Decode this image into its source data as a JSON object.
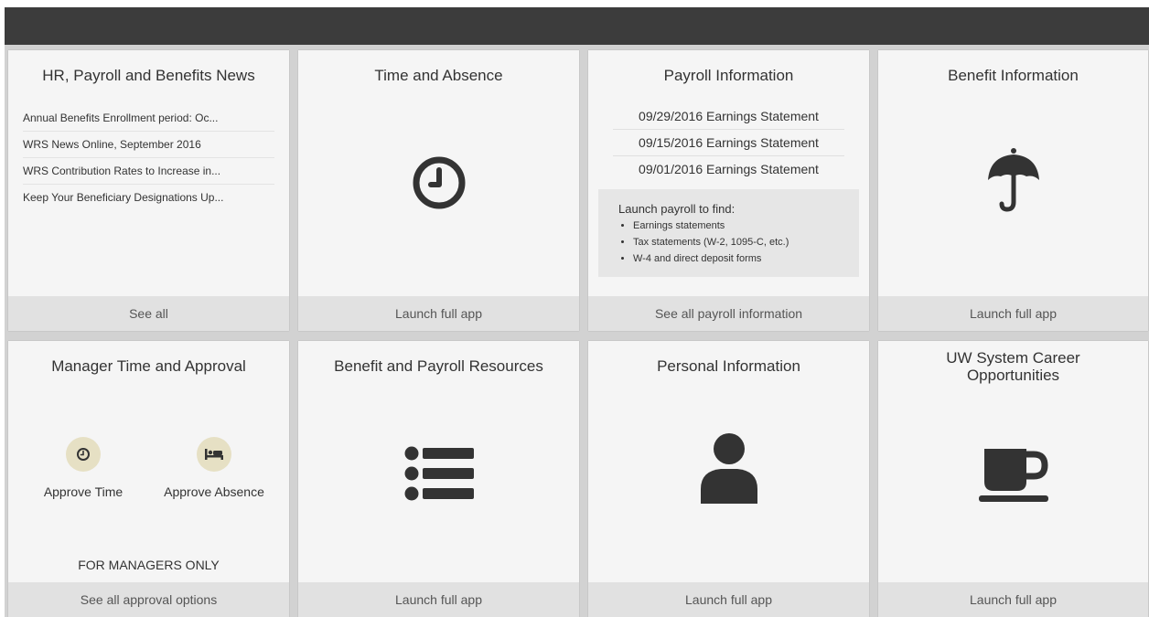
{
  "tiles": {
    "news": {
      "title": "HR, Payroll and Benefits News",
      "items": [
        "Annual Benefits Enrollment period: Oc...",
        "WRS News Online, September 2016",
        "WRS Contribution Rates to Increase in...",
        "Keep Your Beneficiary Designations Up..."
      ],
      "footer": "See all"
    },
    "time_absence": {
      "title": "Time and Absence",
      "icon": "clock-icon",
      "footer": "Launch full app"
    },
    "payroll": {
      "title": "Payroll Information",
      "statements": [
        "09/29/2016 Earnings Statement",
        "09/15/2016 Earnings Statement",
        "09/01/2016 Earnings Statement"
      ],
      "launch_heading": "Launch payroll to find:",
      "launch_items": [
        "Earnings statements",
        "Tax statements (W-2, 1095-C, etc.)",
        "W-4 and direct deposit forms"
      ],
      "footer": "See all payroll information"
    },
    "benefit": {
      "title": "Benefit Information",
      "icon": "umbrella-icon",
      "footer": "Launch full app"
    },
    "manager": {
      "title": "Manager Time and Approval",
      "approve_time": "Approve Time",
      "approve_absence": "Approve Absence",
      "note": "FOR MANAGERS ONLY",
      "footer": "See all approval options"
    },
    "resources": {
      "title": "Benefit and Payroll Resources",
      "icon": "list-icon",
      "footer": "Launch full app"
    },
    "personal": {
      "title": "Personal Information",
      "icon": "user-icon",
      "footer": "Launch full app"
    },
    "career": {
      "title": "UW System Career Opportunities",
      "icon": "coffee-cup-icon",
      "footer": "Launch full app"
    }
  },
  "colors": {
    "topbar": "#3c3c3c",
    "card_bg": "#f5f5f5",
    "footer_bg": "#e1e1e1",
    "grid_bg": "#d2d2d2",
    "icon": "#333333",
    "approve_circle": "#e6e0c4"
  }
}
